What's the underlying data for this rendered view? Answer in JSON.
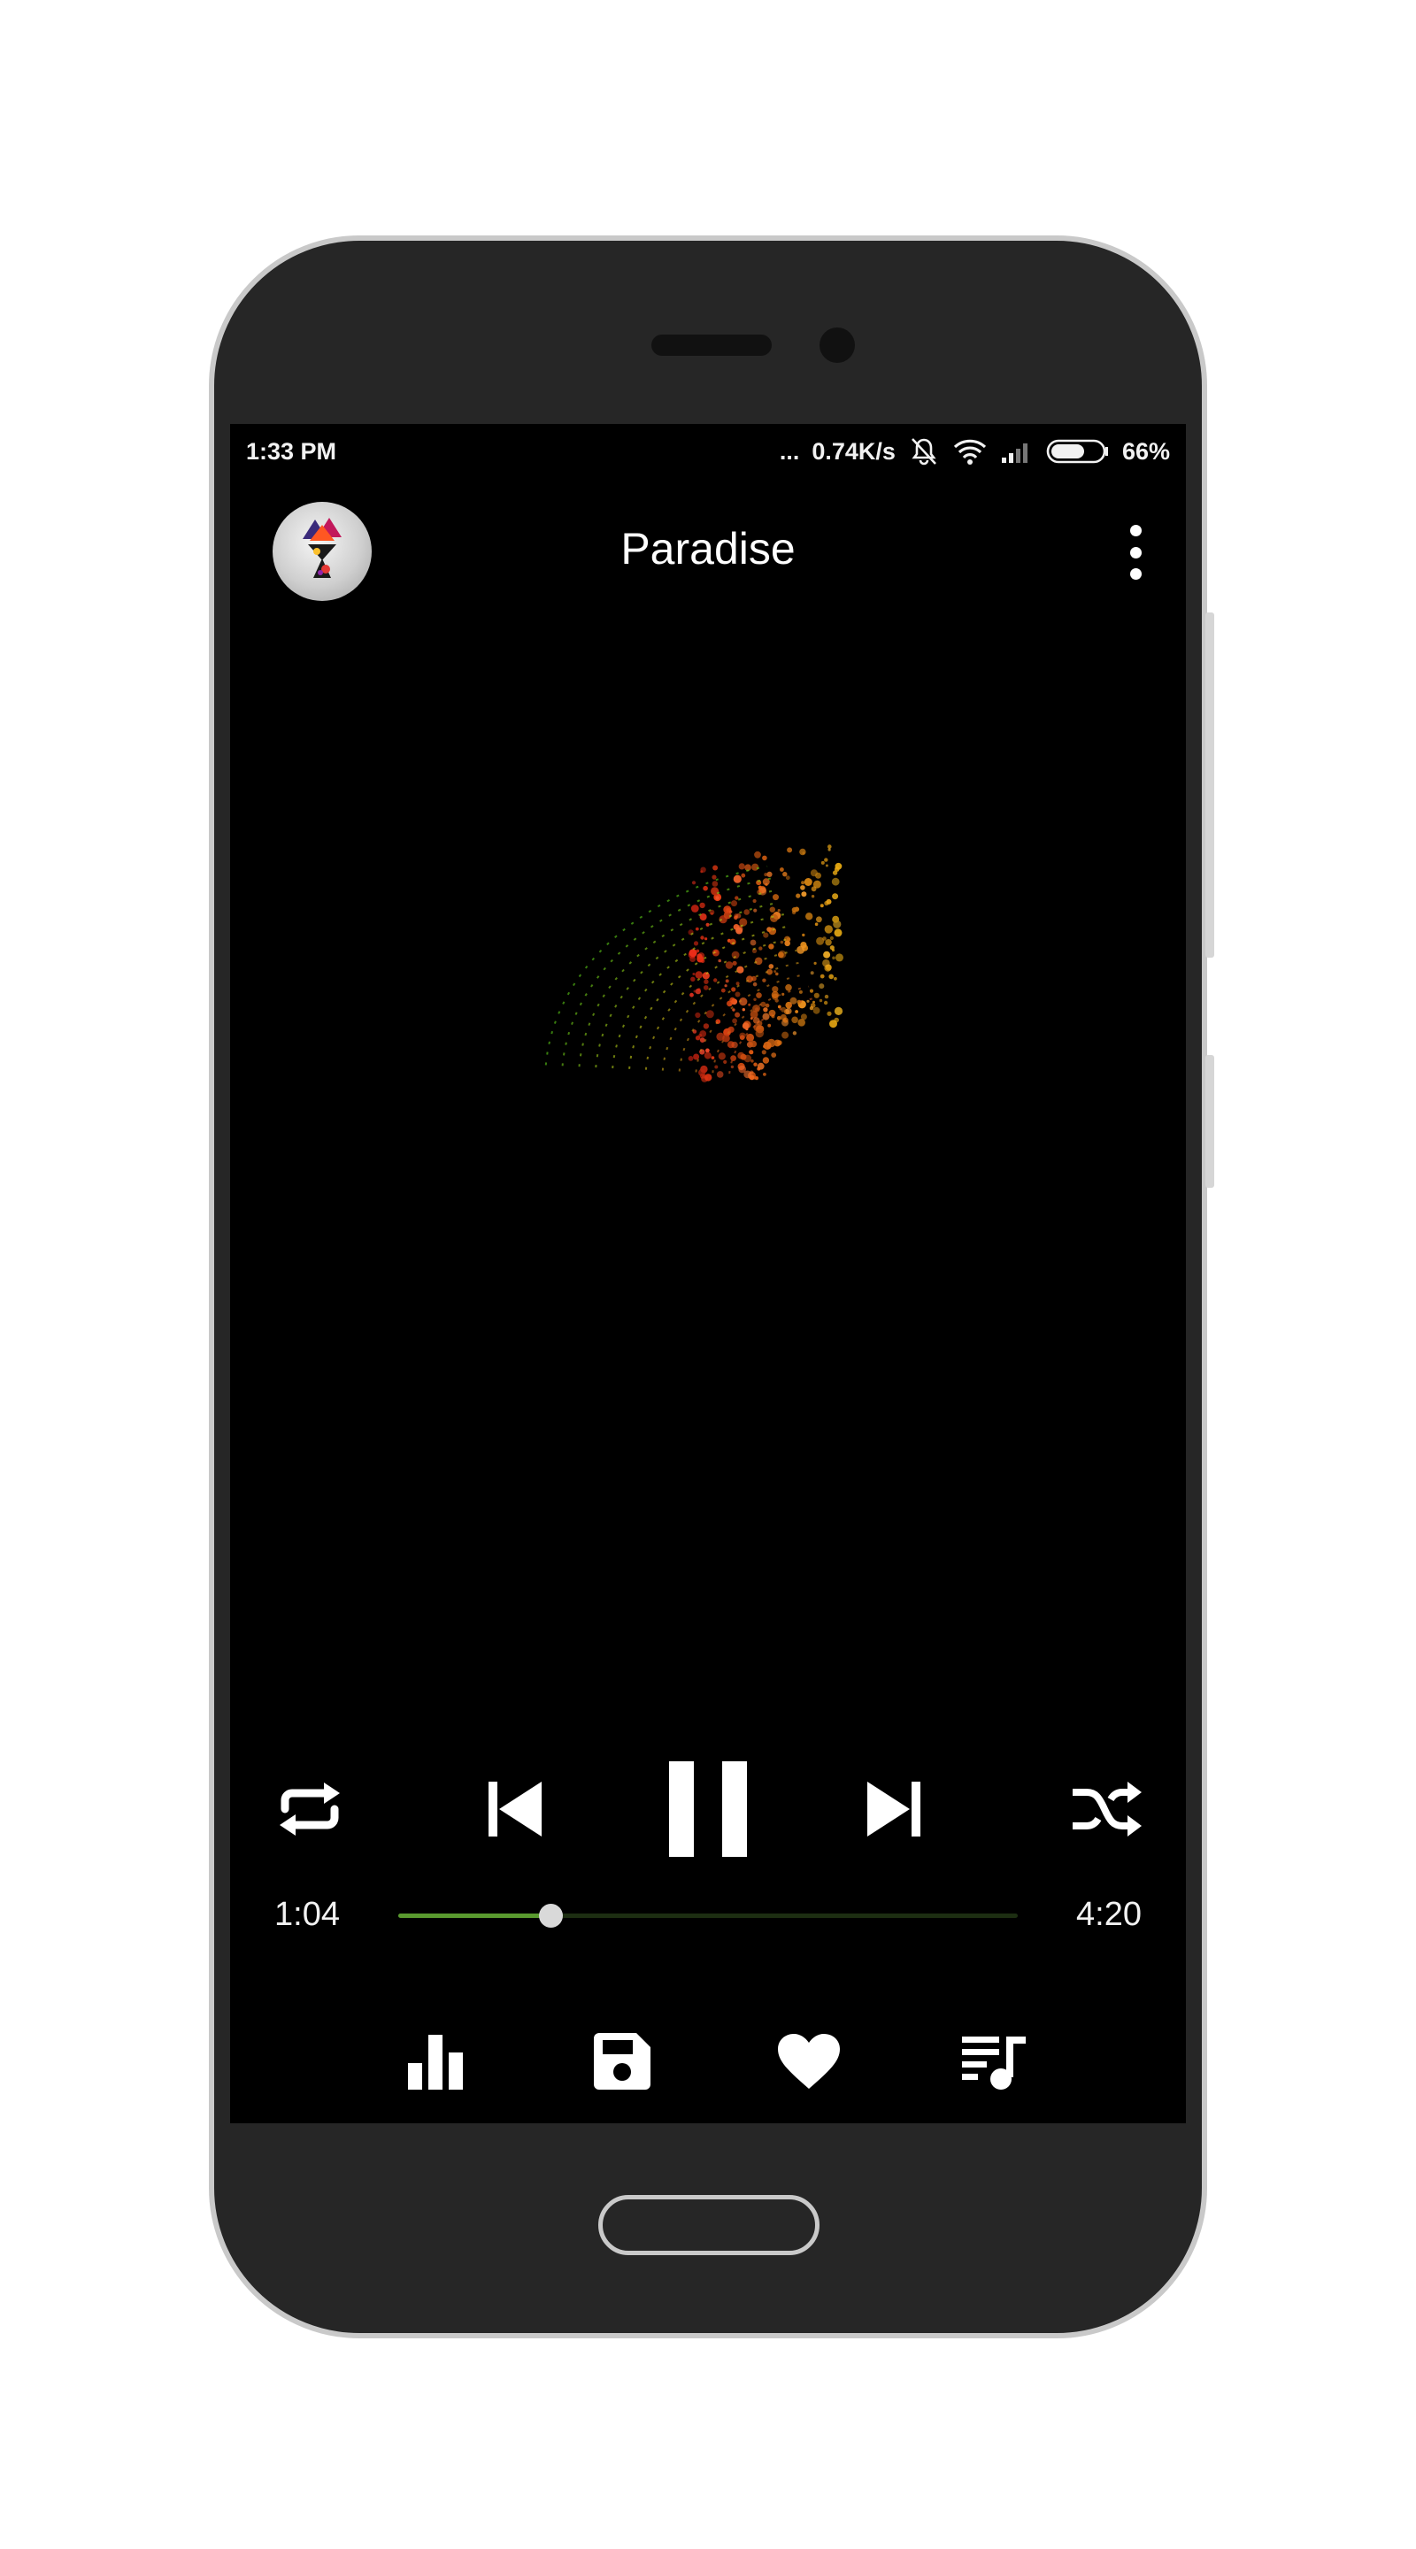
{
  "status_bar": {
    "time": "1:33 PM",
    "dots": "...",
    "net_speed": "0.74K/s",
    "battery_percent": "66%",
    "battery_level": 0.66
  },
  "header": {
    "title": "Paradise",
    "avatar_icon": "album-art-avatar",
    "menu_icon": "more-vert-icon"
  },
  "controls": {
    "repeat_icon": "repeat-icon",
    "previous_icon": "skip-previous-icon",
    "pause_icon": "pause-icon",
    "next_icon": "skip-next-icon",
    "shuffle_icon": "shuffle-icon"
  },
  "progress": {
    "current_time": "1:04",
    "duration": "4:20",
    "fraction": 0.246
  },
  "actions": {
    "equalizer_icon": "equalizer-icon",
    "save_icon": "save-icon",
    "favorite_icon": "heart-icon",
    "queue_icon": "queue-music-icon"
  },
  "colors": {
    "accent": "#5a9a2f",
    "track_bg": "#1d2e12",
    "screen_bg": "#000000",
    "device_body": "#262626"
  }
}
